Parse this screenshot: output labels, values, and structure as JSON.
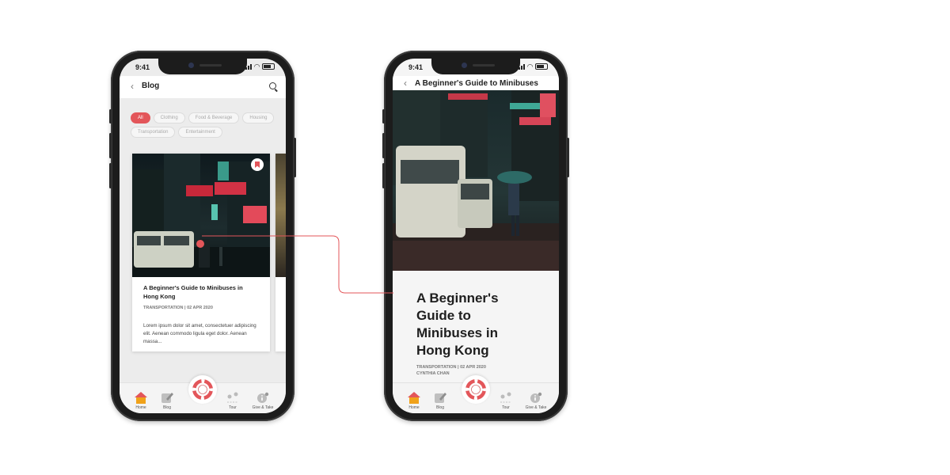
{
  "status": {
    "time": "9:41"
  },
  "blog_screen": {
    "nav_title": "Blog",
    "chips": [
      {
        "label": "All",
        "active": true
      },
      {
        "label": "Clothing",
        "active": false
      },
      {
        "label": "Food & Beverage",
        "active": false
      },
      {
        "label": "Housing",
        "active": false
      },
      {
        "label": "Transportation",
        "active": false
      },
      {
        "label": "Entertainment",
        "active": false
      }
    ],
    "card": {
      "title": "A Beginner's Guide to Minibuses in Hong Kong",
      "meta": "TRANSPORTATION | 02 APR 2020",
      "excerpt": "Lorem ipsum dolor sit amet, consectetuer adipiscing elit. Aenean commodo ligula eget dolor. Aenean massa..."
    }
  },
  "article_screen": {
    "nav_title": "A Beginner's Guide to Minibuses",
    "title": "A Beginner's Guide to Minibuses in Hong Kong",
    "meta_line1": "TRANSPORTATION | 02 APR 2020",
    "meta_line2": "CYNTHIA CHAN"
  },
  "tabbar": {
    "home": "Home",
    "blog": "Blog",
    "tour": "Tour",
    "give_take": "Give & Take"
  },
  "colors": {
    "accent": "#e3565a",
    "home_icon": "#f0a21a"
  }
}
